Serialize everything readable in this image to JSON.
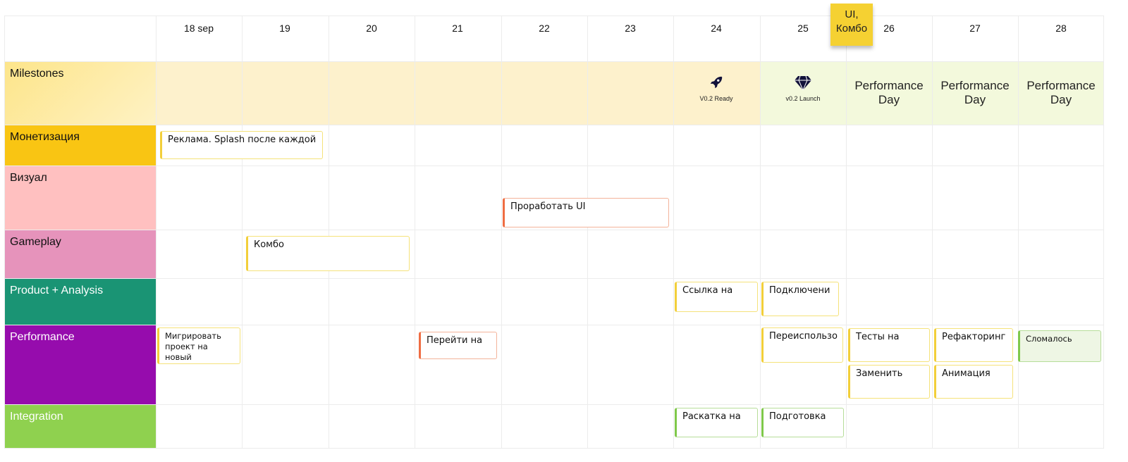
{
  "days": [
    "18 sep",
    "19",
    "20",
    "21",
    "22",
    "23",
    "24",
    "25",
    "26",
    "27",
    "28"
  ],
  "rows": [
    {
      "label": "Milestones",
      "color": "#fde79a"
    },
    {
      "label": "Монетизация",
      "color": "#f9c513"
    },
    {
      "label": "Визуал",
      "color": "#ffc0c0"
    },
    {
      "label": "Gameplay",
      "color": "#e693bb"
    },
    {
      "label": "Product + Analysis",
      "color": "#1a9474"
    },
    {
      "label": "Performance",
      "color": "#960cad"
    },
    {
      "label": "Integration",
      "color": "#8fd14f"
    }
  ],
  "milestones": [
    {
      "day": "24",
      "icon": "rocket-icon",
      "label": "V0.2 Ready"
    },
    {
      "day": "25",
      "icon": "diamond-icon",
      "label": "v0.2 Launch"
    },
    {
      "day": "26",
      "label": "Performance Day"
    },
    {
      "day": "27",
      "label": "Performance Day"
    },
    {
      "day": "28",
      "label": "Performance Day"
    }
  ],
  "cards": {
    "reklama": "Реклама. Splash после каждой",
    "ui": "Проработать UI",
    "kombo": "Комбо",
    "ssylka": "Ссылка на",
    "podkl": "Подключени",
    "migr": "Мигрировать проект на новый",
    "pereiti": "Перейти на",
    "pereisp": "Переиспользо",
    "testy": "Тесты на",
    "zamenit": "Заменить",
    "refact": "Рефакторинг",
    "anim": "Анимация",
    "slomalos": "Сломалось",
    "raskatka": "Раскатка на",
    "podgotovka": "Подготовка"
  },
  "sticky_note": "UI, Комбо"
}
